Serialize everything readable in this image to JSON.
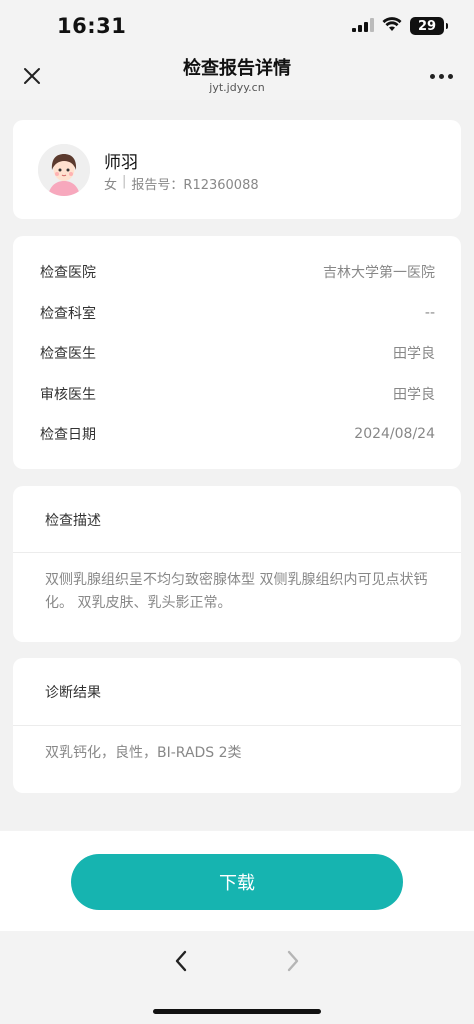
{
  "status_bar": {
    "time": "16:31",
    "battery": "29",
    "icons": [
      "signal-icon",
      "wifi-icon",
      "battery-icon"
    ]
  },
  "nav": {
    "title": "检查报告详情",
    "subtitle": "jyt.jdyy.cn",
    "close_icon": "close-icon",
    "more_icon": "more-icon"
  },
  "patient": {
    "name": "师羽",
    "gender": "女",
    "report_label": "报告号：R12360088"
  },
  "info": {
    "rows": [
      {
        "label": "检查医院",
        "value": "吉林大学第一医院"
      },
      {
        "label": "检查科室",
        "value": "--"
      },
      {
        "label": "检查医生",
        "value": "田学良"
      },
      {
        "label": "审核医生",
        "value": "田学良"
      },
      {
        "label": "检查日期",
        "value": "2024/08/24"
      }
    ]
  },
  "description": {
    "title": "检查描述",
    "text": "双侧乳腺组织呈不均匀致密腺体型 双侧乳腺组织内可见点状钙化。 双乳皮肤、乳头影正常。"
  },
  "diagnosis": {
    "title": "诊断结果",
    "text": "双乳钙化，良性，BI-RADS 2类"
  },
  "actions": {
    "download_label": "下载"
  },
  "colors": {
    "accent": "#16b4b0",
    "background": "#f3f3f3"
  }
}
